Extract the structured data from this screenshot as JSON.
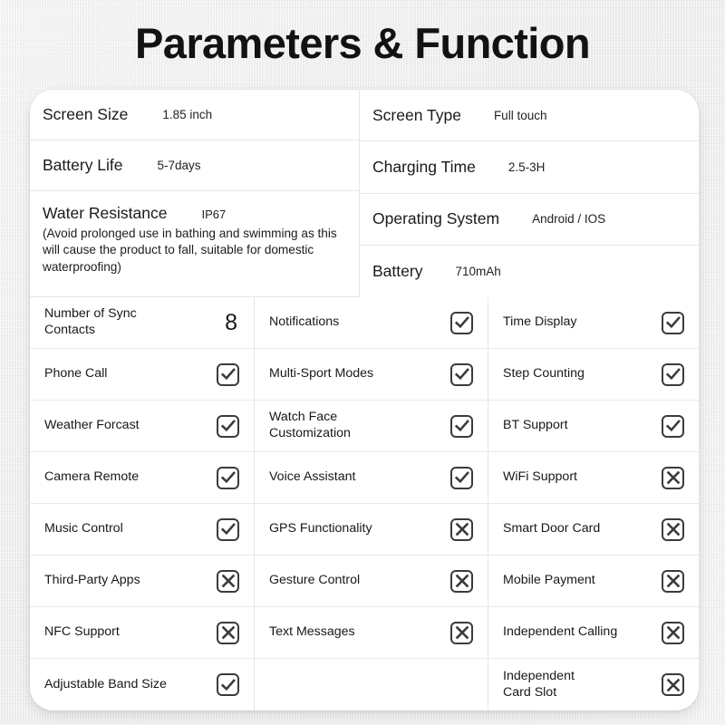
{
  "page": {
    "title": "Parameters & Function"
  },
  "spec": {
    "left": [
      {
        "label": "Screen Size",
        "value": "1.85 inch"
      },
      {
        "label": "Battery Life",
        "value": "5-7days"
      }
    ],
    "water": {
      "label": "Water Resistance",
      "value": "IP67",
      "note": "(Avoid prolonged use in bathing and swimming as this will cause the product to fall, suitable for domestic waterproofing)"
    },
    "right": [
      {
        "label": "Screen Type",
        "value": "Full touch"
      },
      {
        "label": "Charging Time",
        "value": "2.5-3H"
      },
      {
        "label": "Operating System",
        "value": "Android / IOS"
      },
      {
        "label": "Battery",
        "value": "710mAh"
      }
    ]
  },
  "features": {
    "columns": [
      [
        {
          "label": "Number of Sync\nContacts",
          "mark": "number",
          "value": "8"
        },
        {
          "label": "Phone Call",
          "mark": "check"
        },
        {
          "label": "Weather Forcast",
          "mark": "check"
        },
        {
          "label": "Camera Remote",
          "mark": "check"
        },
        {
          "label": "Music Control",
          "mark": "check"
        },
        {
          "label": "Third-Party Apps",
          "mark": "cross"
        },
        {
          "label": "NFC Support",
          "mark": "cross"
        },
        {
          "label": "Adjustable Band Size",
          "mark": "check"
        }
      ],
      [
        {
          "label": "Notifications",
          "mark": "check"
        },
        {
          "label": "Multi-Sport Modes",
          "mark": "check"
        },
        {
          "label": "Watch Face\nCustomization",
          "mark": "check"
        },
        {
          "label": "Voice Assistant",
          "mark": "check"
        },
        {
          "label": "GPS Functionality",
          "mark": "cross"
        },
        {
          "label": "Gesture Control",
          "mark": "cross"
        },
        {
          "label": "Text Messages",
          "mark": "cross"
        },
        {
          "label": "",
          "mark": "none"
        }
      ],
      [
        {
          "label": "Time Display",
          "mark": "check"
        },
        {
          "label": "Step Counting",
          "mark": "check"
        },
        {
          "label": "BT Support",
          "mark": "check"
        },
        {
          "label": "WiFi Support",
          "mark": "cross"
        },
        {
          "label": "Smart Door Card",
          "mark": "cross"
        },
        {
          "label": "Mobile Payment",
          "mark": "cross"
        },
        {
          "label": "Independent Calling",
          "mark": "cross"
        },
        {
          "label": "Independent\nCard Slot",
          "mark": "cross"
        }
      ]
    ]
  },
  "icons": {
    "check": "checkmark-icon",
    "cross": "cross-icon"
  },
  "colors": {
    "background": "#eeeeee",
    "card": "#ffffff",
    "text": "#1a1a1a",
    "divider": "#e6e6e6",
    "mark_stroke": "#3b3b3b"
  }
}
